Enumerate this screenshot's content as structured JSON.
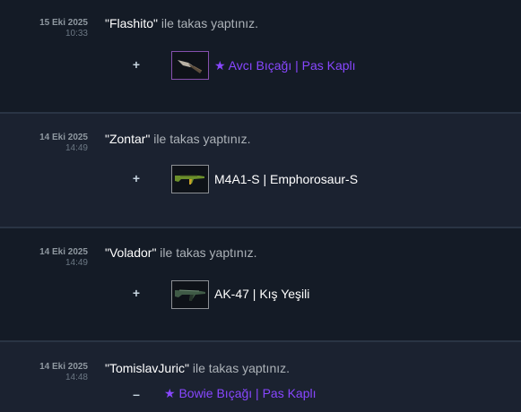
{
  "trades": [
    {
      "date": "15 Eki 2025",
      "time": "10:33",
      "partner": "\"Flashito\"",
      "action_text": " ile takas yaptınız.",
      "sign": "+",
      "item": {
        "name": "★ Avcı Bıçağı | Pas Kaplı",
        "icon": "knife-icon",
        "color": "#8847ff"
      }
    },
    {
      "date": "14 Eki 2025",
      "time": "14:49",
      "partner": "\"Zontar\"",
      "action_text": " ile takas yaptınız.",
      "sign": "+",
      "item": {
        "name": "M4A1-S | Emphorosaur-S",
        "icon": "rifle-icon",
        "color": "#ffffff"
      }
    },
    {
      "date": "14 Eki 2025",
      "time": "14:49",
      "partner": "\"Volador\"",
      "action_text": " ile takas yaptınız.",
      "sign": "+",
      "item": {
        "name": "AK-47 | Kış Yeşili",
        "icon": "rifle-icon",
        "color": "#ffffff"
      }
    },
    {
      "date": "14 Eki 2025",
      "time": "14:48",
      "partner": "\"TomislavJuric\"",
      "action_text": " ile takas yaptınız.",
      "sign": "–",
      "item": {
        "name": "★ Bowie Bıçağı | Pas Kaplı",
        "icon": "knife-icon",
        "color": "#8847ff"
      }
    }
  ]
}
